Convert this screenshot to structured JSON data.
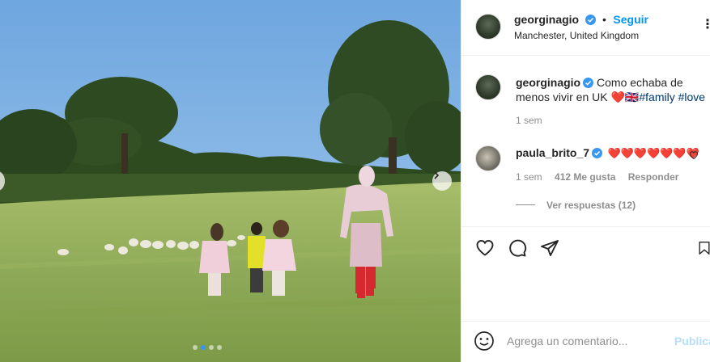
{
  "post": {
    "author": "georginagio",
    "location": "Manchester, United Kingdom",
    "follow_label": "Seguir",
    "more_label": "⋮",
    "carousel": {
      "slides": 4,
      "active_index": 1
    }
  },
  "caption": {
    "username": "georginagio",
    "line1": "Como echaba de",
    "line2_text": "menos vivir en UK",
    "line2_emoji": "❤️🇬🇧",
    "hashtags": "#family #love",
    "time": "1 sem"
  },
  "comments": [
    {
      "username": "paula_brito_7",
      "text": "❤️❤️❤️❤️❤️❤️❤️",
      "time": "1 sem",
      "likes": "412 Me gusta",
      "reply_label": "Responder",
      "view_replies": "Ver respuestas (12)"
    }
  ],
  "comment_box": {
    "placeholder": "Agrega un comentario...",
    "submit_label": "Publica"
  },
  "colors": {
    "accent": "#0095f6",
    "verified": "#3897f0",
    "heart": "#ed4956"
  },
  "icons": [
    "heart-icon",
    "comment-icon",
    "share-icon",
    "bookmark-icon",
    "emoji-icon",
    "verified-icon",
    "chevron-right-icon"
  ]
}
